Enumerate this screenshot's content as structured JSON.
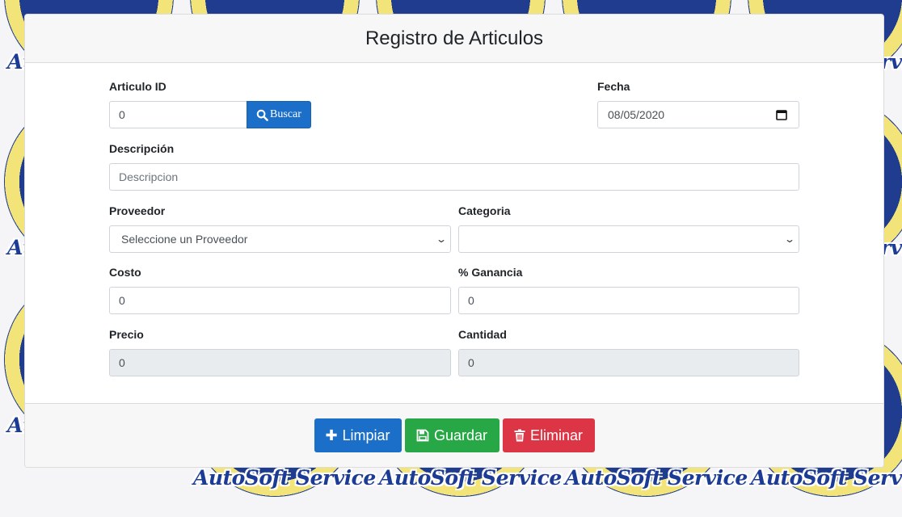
{
  "background": {
    "logo_text": "AutoSoft Service"
  },
  "header": {
    "title": "Registro de Articulos"
  },
  "form": {
    "articulo_id": {
      "label": "Articulo ID",
      "value": "0"
    },
    "buscar_label": "Buscar",
    "fecha": {
      "label": "Fecha",
      "value": "08/05/2020"
    },
    "descripcion": {
      "label": "Descripción",
      "placeholder": "Descripcion"
    },
    "proveedor": {
      "label": "Proveedor",
      "selected": "Seleccione un Proveedor"
    },
    "categoria": {
      "label": "Categoria",
      "selected": ""
    },
    "costo": {
      "label": "Costo",
      "value": "0"
    },
    "ganancia": {
      "label": "% Ganancia",
      "value": "0"
    },
    "precio": {
      "label": "Precio",
      "value": "0"
    },
    "cantidad": {
      "label": "Cantidad",
      "value": "0"
    }
  },
  "footer": {
    "limpiar_label": "Limpiar",
    "guardar_label": "Guardar",
    "eliminar_label": "Eliminar"
  },
  "icons": {
    "search": "search-icon",
    "calendar": "calendar-icon",
    "plus": "plus-icon",
    "save": "floppy-disk-icon",
    "trash": "trash-icon"
  },
  "colors": {
    "primary": "#1b6fc8",
    "success": "#27a745",
    "danger": "#dc3545",
    "logo_blue": "#1f3c8f",
    "logo_yellow": "#f2e479"
  }
}
